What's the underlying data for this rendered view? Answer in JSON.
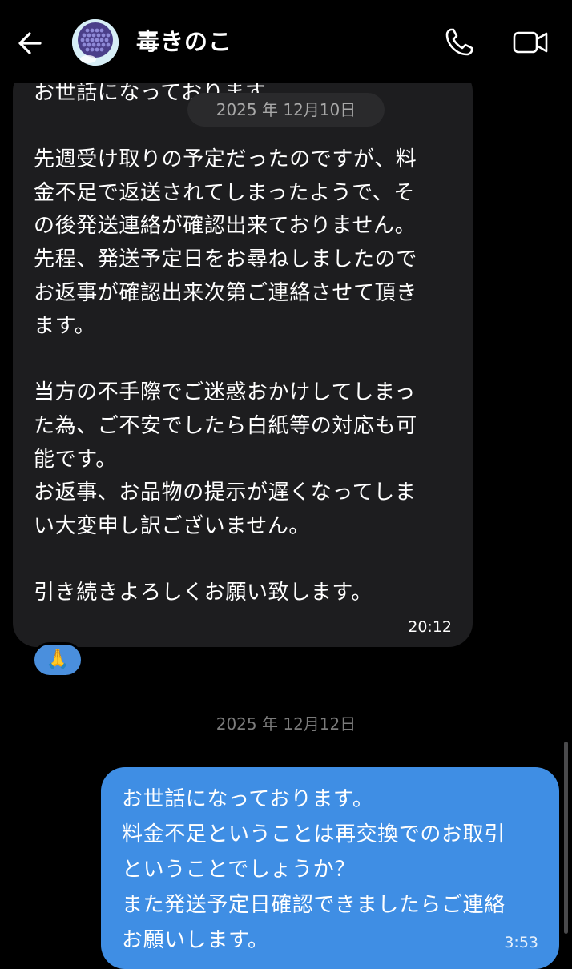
{
  "header": {
    "contact_name": "毒きのこ"
  },
  "icons": {
    "back": "arrow-left-icon",
    "call": "phone-icon",
    "video": "video-camera-icon"
  },
  "messages": {
    "incoming": {
      "text": "お世話になっております。\n\n先週受け取りの予定だったのですが、料\n金不足で返送されてしまったようで、そ\nの後発送連絡が確認出来ておりません。\n先程、発送予定日をお尋ねしましたので\nお返事が確認出来次第ご連絡させて頂き\nます。\n\n当方の不手際でご迷惑おかけしてしまっ\nた為、ご不安でしたら白紙等の対応も可\n能です。\nお返事、お品物の提示が遅くなってしま\nい大変申し訳ございません。\n\n引き続きよろしくお願い致します。",
      "time": "20:12",
      "reaction": "🙏"
    },
    "outgoing": {
      "text": "お世話になっております。\n料金不足ということは再交換でのお取引\nということでしょうか？\nまた発送予定日確認できましたらご連絡\nお願いします。",
      "time": "3:53"
    }
  },
  "dates": {
    "floating": "2025 年 12月10日",
    "separator": "2025 年 12月12日"
  },
  "colors": {
    "background": "#000000",
    "incoming_bubble": "#1d1d1f",
    "outgoing_bubble": "#3f8ee4"
  }
}
